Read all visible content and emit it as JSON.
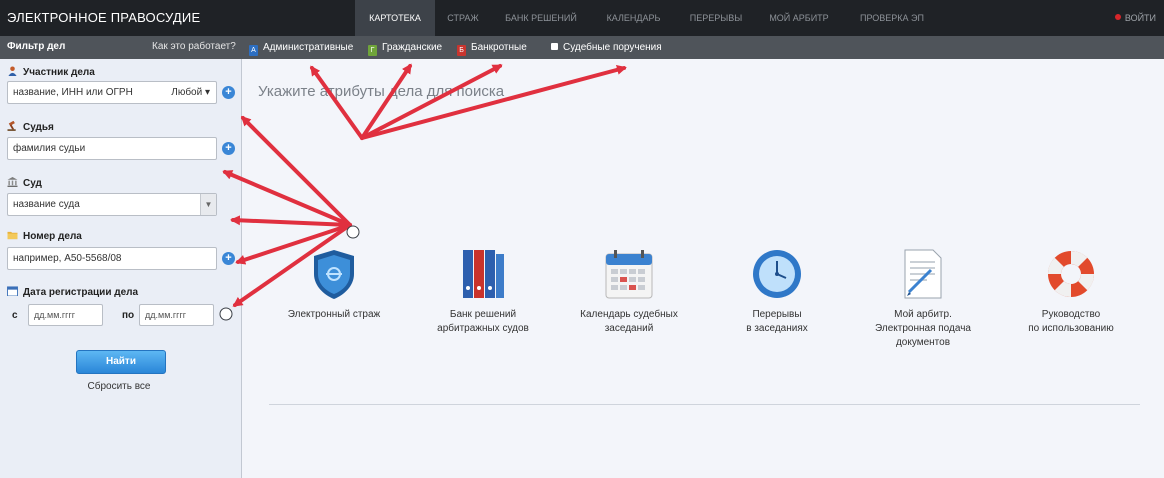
{
  "brand": "ЭЛЕКТРОННОЕ ПРАВОСУДИЕ",
  "nav": {
    "items": [
      "КАРТОТЕКА",
      "СТРАЖ",
      "БАНК РЕШЕНИЙ",
      "КАЛЕНДАРЬ",
      "ПЕРЕРЫВЫ",
      "МОЙ АРБИТР",
      "ПРОВЕРКА ЭП"
    ],
    "active": "КАРТОТЕКА",
    "logout": "ВОЙТИ"
  },
  "subbar": {
    "filter_title": "Фильтр дел",
    "how_link": "Как это работает?",
    "categories": [
      {
        "label": "Административные",
        "letter": "А",
        "color": "#2d6fc2"
      },
      {
        "label": "Гражданские",
        "letter": "Г",
        "color": "#6fa43a"
      },
      {
        "label": "Банкротные",
        "letter": "Б",
        "color": "#c8352f"
      },
      {
        "label": "Судебные поручения",
        "letter": "",
        "color": "#ffffff"
      }
    ]
  },
  "filter": {
    "participant": {
      "label": "Участник дела",
      "placeholder": "название, ИНН или ОГРН",
      "role": "Любой"
    },
    "judge": {
      "label": "Судья",
      "placeholder": "фамилия судьи"
    },
    "court": {
      "label": "Суд",
      "placeholder": "название суда"
    },
    "case_number": {
      "label": "Номер дела",
      "placeholder": "например, А50-5568/08"
    },
    "date": {
      "label": "Дата регистрации дела",
      "from_label": "с",
      "to_label": "по",
      "from_placeholder": "дд.мм.гггг",
      "to_placeholder": "дд.мм.гггг"
    },
    "find_button": "Найти",
    "reset_link": "Сбросить все"
  },
  "main": {
    "prompt": "Укажите атрибуты дела для поиска",
    "tiles": [
      {
        "caption": "Электронный страж",
        "icon": "shield-icon"
      },
      {
        "caption": "Банк решений\nарбитражных судов",
        "icon": "binders-icon"
      },
      {
        "caption": "Календарь судебных\nзаседаний",
        "icon": "calendar-icon"
      },
      {
        "caption": "Перерывы\nв заседаниях",
        "icon": "clock-icon"
      },
      {
        "caption": "Мой арбитр.\nЭлектронная подача\nдокументов",
        "icon": "document-icon"
      },
      {
        "caption": "Руководство\nпо использованию",
        "icon": "lifebuoy-icon"
      }
    ]
  },
  "colors": {
    "topbar": "#1f2226",
    "subbar": "#4f545a",
    "sidebar": "#eaeef6",
    "accent_blue": "#2a86d8",
    "annotation_arrow": "#e0303f"
  }
}
